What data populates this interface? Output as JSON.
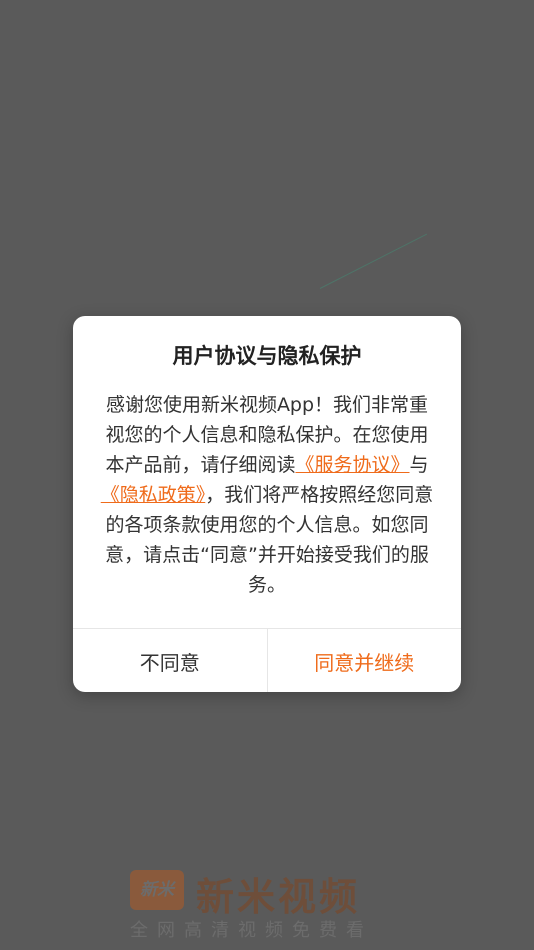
{
  "splash": {
    "logo_text": "新米",
    "app_name": "新米视频",
    "slogan": "全网高清视频免费看"
  },
  "dialog": {
    "title": "用户协议与隐私保护",
    "body_part1": "感谢您使用新米视频App！我们非常重视您的个人信息和隐私保护。在您使用本产品前，请仔细阅读",
    "service_link": "《服务协议》",
    "body_and": "与",
    "privacy_link": "《隐私政策》",
    "body_part2": "，我们将严格按照经您同意的各项条款使用您的个人信息。如您同意，请点击“同意”并开始接受我们的服务。",
    "disagree_label": "不同意",
    "agree_label": "同意并继续"
  },
  "colors": {
    "accent": "#ef6b1b",
    "overlay_background": "#5a5a5a",
    "dialog_background": "#ffffff"
  }
}
